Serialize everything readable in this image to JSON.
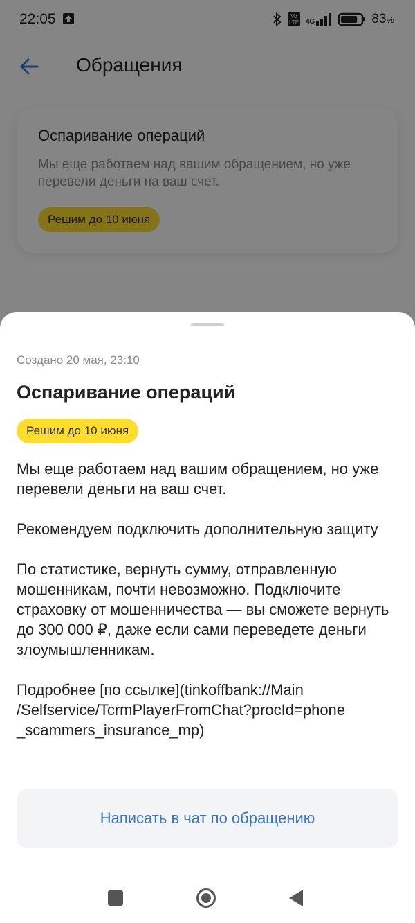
{
  "status_bar": {
    "time": "22:05",
    "battery_pct": "83",
    "battery_unit": "%",
    "volte_label": "Vo LTE",
    "network_label": "4G",
    "battery_level": 0.83,
    "icons": [
      "upload-arrow-icon",
      "bluetooth-icon",
      "volte-icon",
      "signal-4g-icon",
      "battery-icon"
    ]
  },
  "app_bar": {
    "title": "Обращения"
  },
  "background_card": {
    "title": "Оспаривание операций",
    "description": "Мы еще работаем над вашим обращением, но уже перевели деньги на ваш счет.",
    "badge": "Решим до 10 июня"
  },
  "sheet": {
    "created": "Создано 20 мая, 23:10",
    "title": "Оспаривание операций",
    "badge": "Решим до 10 июня",
    "paragraphs": [
      "Мы еще работаем над вашим обращением, но уже перевели деньги на ваш счет.",
      "Рекомендуем подключить дополнительную защиту",
      "По статистике, вернуть сумму, отправленную мошенникам, почти невозможно. Подключите страховку от мошенничества — вы сможете вернуть до 300 000 ₽, даже если сами переведете деньги злоумышленникам.",
      "Подробнее [по ссылке](tinkoffbank://Main /Selfservice/TcrmPlayerFromChat?procId=phone _scammers_insurance_mp)"
    ],
    "chat_button_label": "Написать в чат по обращению"
  },
  "colors": {
    "accent_yellow": "#ffdd2d",
    "link_blue": "#3a74c4",
    "overlay": "rgba(0,0,0,0.48)"
  }
}
